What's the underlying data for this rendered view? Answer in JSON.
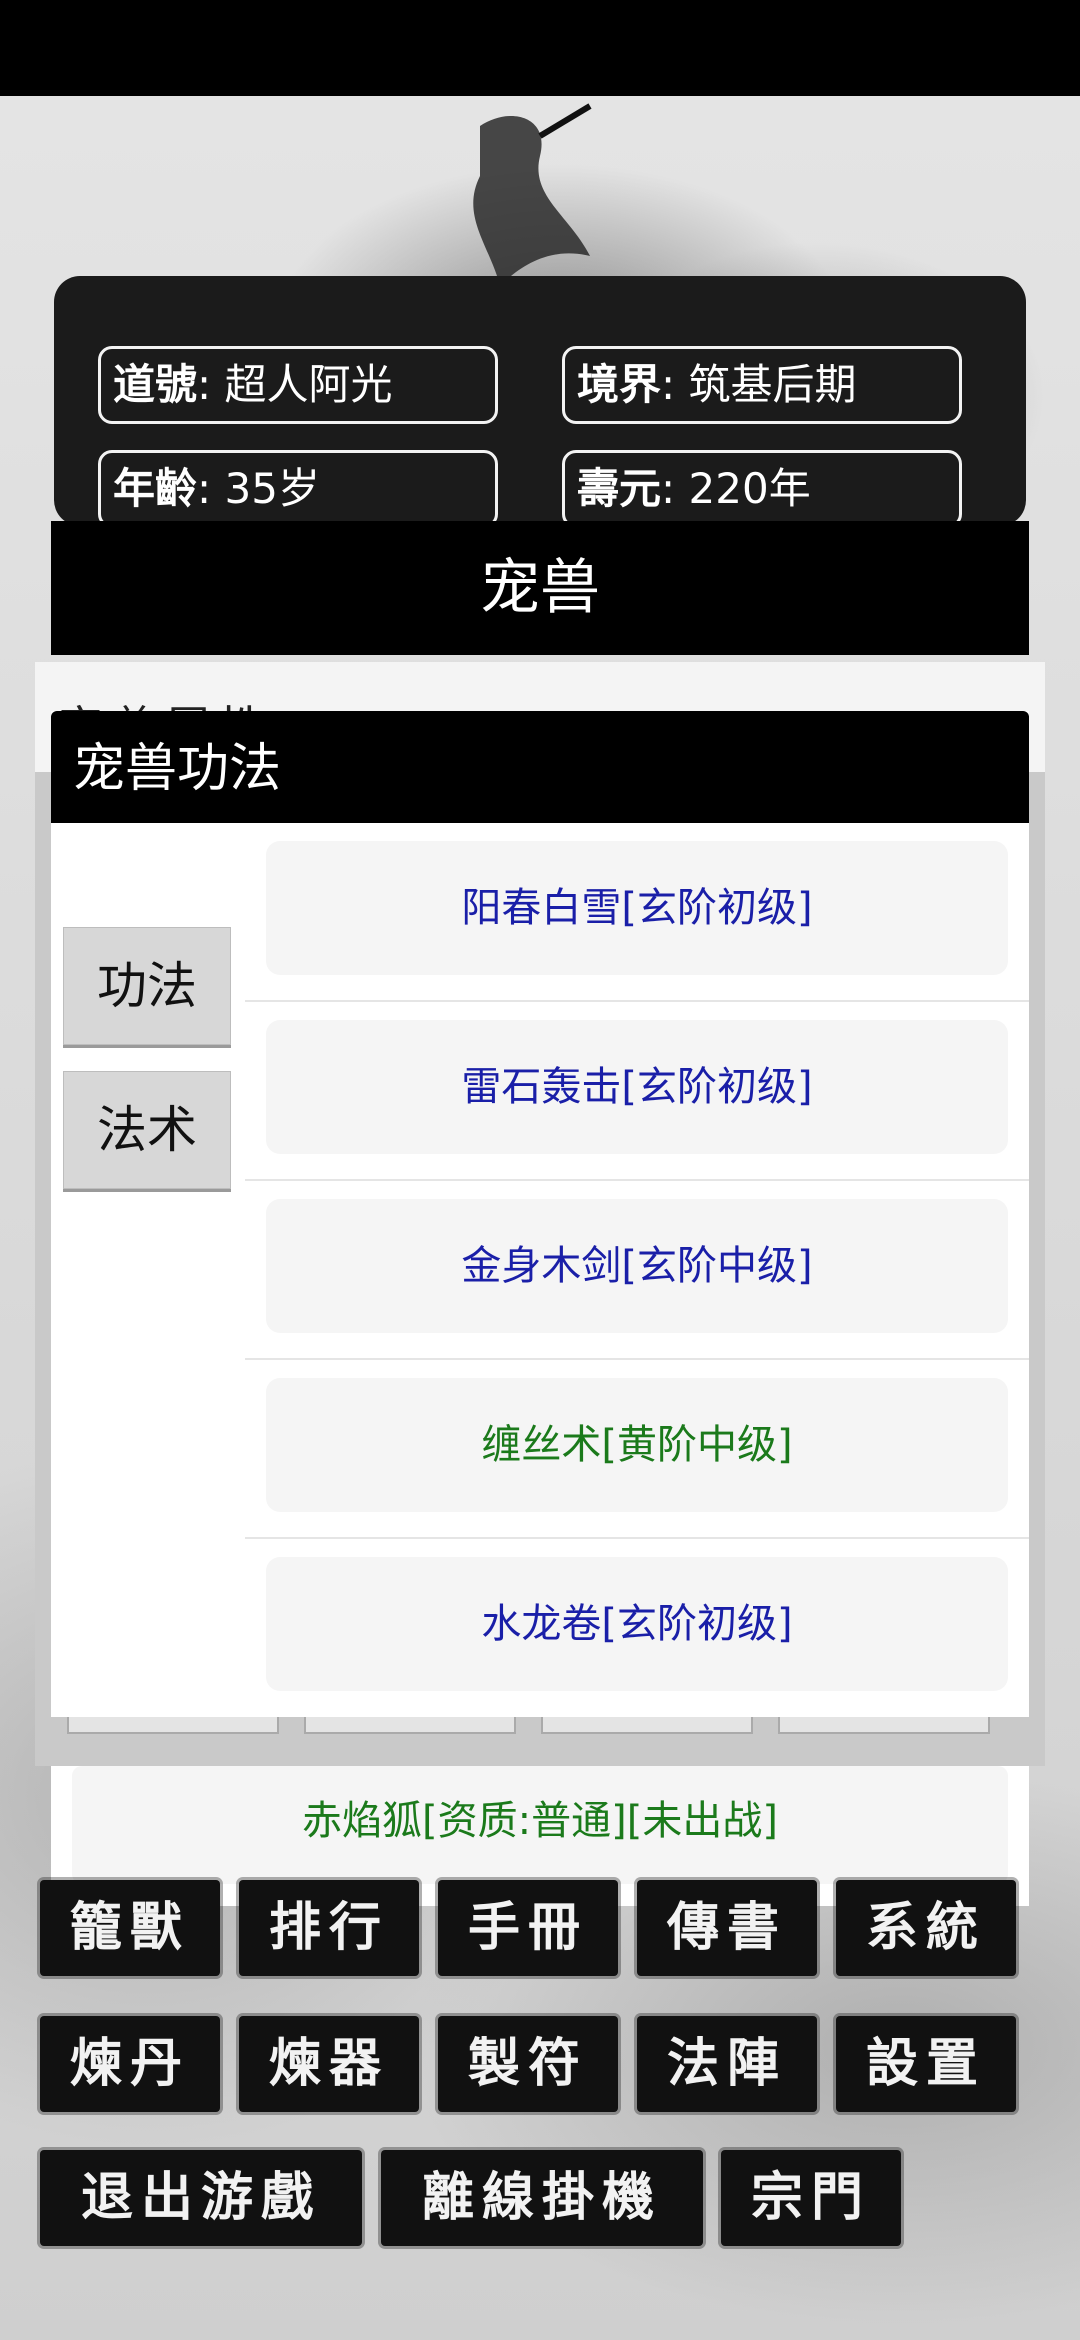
{
  "stats": {
    "name": {
      "key": "道號",
      "value": "超人阿光"
    },
    "realm": {
      "key": "境界",
      "value": "筑基后期"
    },
    "age": {
      "key": "年齡",
      "value": "35岁"
    },
    "lifespan": {
      "key": "壽元",
      "value": "220年"
    }
  },
  "pet_dialog": {
    "title": "宠兽",
    "attr_title": "宠兽属性",
    "pet_entry": "赤焰狐[资质:普通][未出战]"
  },
  "skills_dialog": {
    "title": "宠兽功法",
    "tabs": [
      "功法",
      "法术"
    ],
    "skills": [
      {
        "label": "阳春白雪[玄阶初级]",
        "color": "#1a1fa8"
      },
      {
        "label": "雷石轰击[玄阶初级]",
        "color": "#1a1fa8"
      },
      {
        "label": "金身木剑[玄阶中级]",
        "color": "#1a1fa8"
      },
      {
        "label": "缠丝术[黄阶中级]",
        "color": "#1b7a1b"
      },
      {
        "label": "水龙卷[玄阶初级]",
        "color": "#1a1fa8"
      }
    ]
  },
  "menu": {
    "row1": [
      "籠獸",
      "排行",
      "手冊",
      "傳書",
      "系統"
    ],
    "row2": [
      "煉丹",
      "煉器",
      "製符",
      "法陣",
      "設置"
    ],
    "row3": [
      "退出游戲",
      "離線掛機",
      "宗門"
    ]
  }
}
